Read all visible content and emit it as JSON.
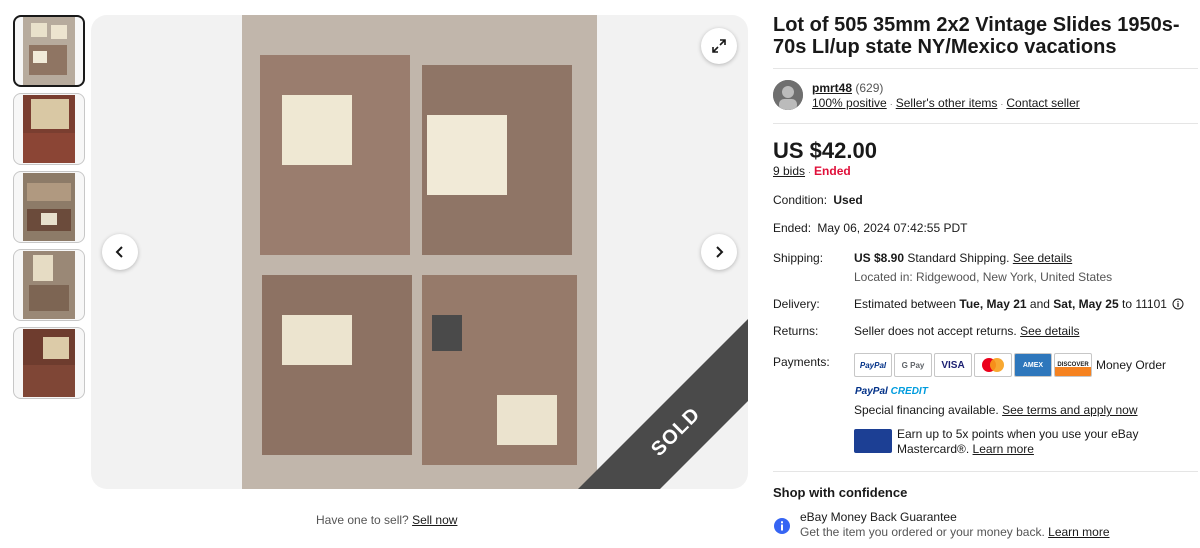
{
  "listing": {
    "title": "Lot of 505 35mm 2x2 Vintage Slides 1950s-70s LI/up state NY/Mexico vacations",
    "sold_badge": "SOLD"
  },
  "gallery": {
    "sell_prompt": "Have one to sell?",
    "sell_link": "Sell now"
  },
  "seller": {
    "name": "pmrt48",
    "feedback_count": "(629)",
    "positive": "100% positive",
    "other_items": "Seller's other items",
    "contact": "Contact seller"
  },
  "price": {
    "amount": "US $42.00",
    "bids": "9 bids",
    "status": "Ended"
  },
  "condition": {
    "label": "Condition:",
    "value": "Used"
  },
  "ended": {
    "label": "Ended:",
    "value": "May 06, 2024 07:42:55 PDT"
  },
  "shipping": {
    "label": "Shipping:",
    "cost": "US $8.90",
    "method": "Standard Shipping",
    "details_link": "See details",
    "location": "Located in: Ridgewood, New York, United States"
  },
  "delivery": {
    "label": "Delivery:",
    "prefix": "Estimated between",
    "start": "Tue, May 21",
    "and": "and",
    "end": "Sat, May 25",
    "to": "to 11101"
  },
  "returns": {
    "label": "Returns:",
    "text": "Seller does not accept returns.",
    "details_link": "See details"
  },
  "payments": {
    "label": "Payments:",
    "methods": [
      "PayPal",
      "G Pay",
      "VISA",
      "Mastercard",
      "AMEX",
      "DISCOVER"
    ],
    "money_order": "Money Order",
    "paypal_credit_a": "PayPal",
    "paypal_credit_b": "CREDIT",
    "financing": "Special financing available.",
    "financing_link": "See terms and apply now",
    "mastercard_text": "Earn up to 5x points when you use your eBay",
    "mastercard_text2": "Mastercard®.",
    "learn_more": "Learn more"
  },
  "confidence": {
    "heading": "Shop with confidence",
    "guarantee_title": "eBay Money Back Guarantee",
    "guarantee_text": "Get the item you ordered or your money back.",
    "learn_more": "Learn more"
  },
  "colors": {
    "ended": "#e0103a",
    "sold_band": "#4a4a4a"
  }
}
